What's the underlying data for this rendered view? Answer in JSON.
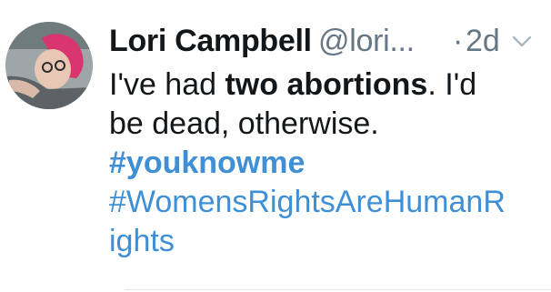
{
  "author": {
    "name": "Lori Campbell",
    "handle": "@lori...",
    "separator": "·",
    "timestamp": "2d"
  },
  "tweet": {
    "line1_pre": "I've had ",
    "line1_bold": "two abortions",
    "line1_post": ". I'd",
    "line2": "be dead, otherwise.",
    "hashtag1": "#youknowme",
    "hashtag2_part1": "#WomensRightsAreHumanR",
    "hashtag2_part2": "ights"
  },
  "icons": {
    "avatar": "profile-photo",
    "menu": "chevron-down-icon"
  },
  "colors": {
    "text": "#14171a",
    "muted": "#657786",
    "link": "#3f8fd6"
  }
}
